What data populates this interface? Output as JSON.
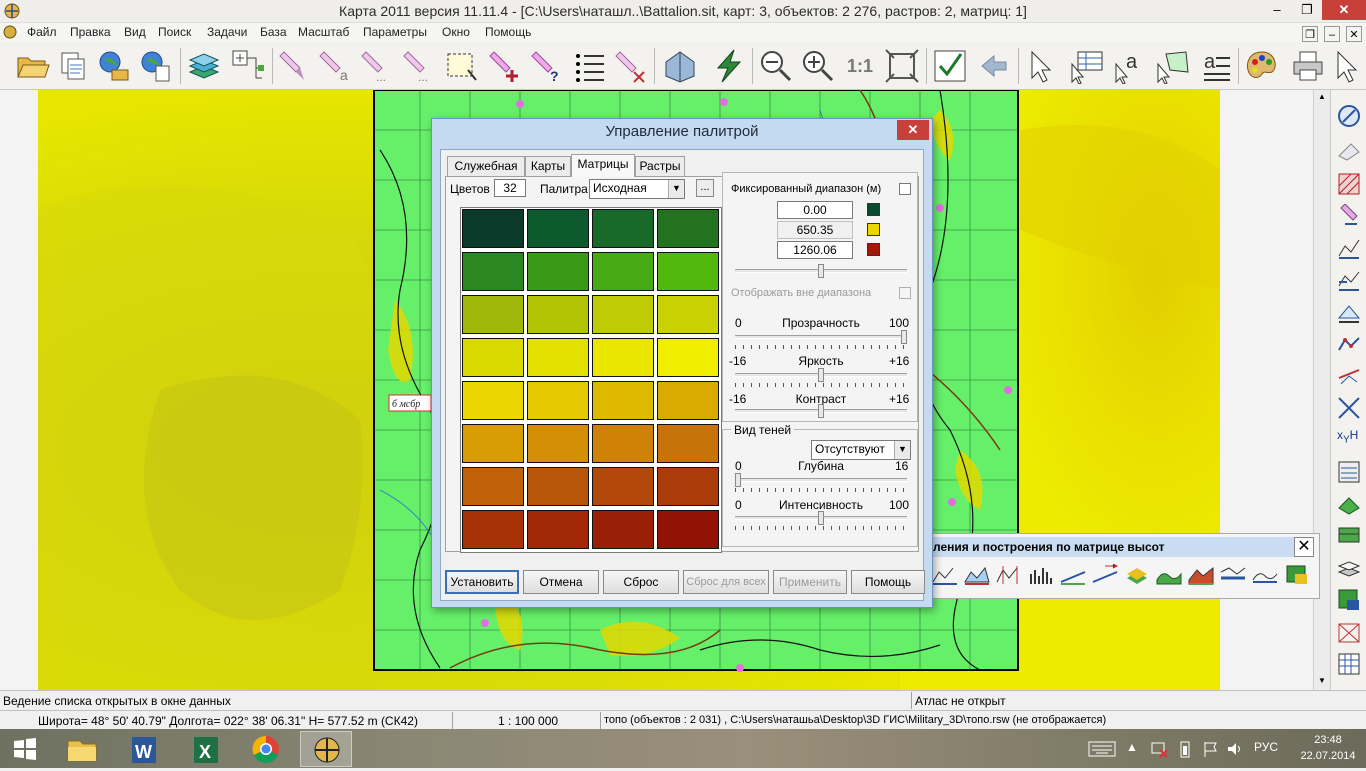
{
  "window": {
    "title": "Карта 2011 версия 11.11.4 - [C:\\Users\\наташл..\\Battalion.sit, карт: 3, объектов: 2 276, растров: 2, матриц: 1]",
    "min": "–",
    "max": "❐",
    "close": "✕"
  },
  "menu": {
    "items": [
      "Файл",
      "Правка",
      "Вид",
      "Поиск",
      "Задачи",
      "База",
      "Масштаб",
      "Параметры",
      "Окно",
      "Помощь"
    ]
  },
  "toolbar": {
    "scale_one": "1:1"
  },
  "map": {
    "unit_label": "б мсбр"
  },
  "matrix_panel": {
    "title": "ления и построения по матрице высот",
    "close": "✕"
  },
  "dialog": {
    "title": "Управление палитрой",
    "close": "✕",
    "tabs": [
      "Служебная",
      "Карты",
      "Матрицы",
      "Растры"
    ],
    "active_tab": "Матрицы",
    "colors_label": "Цветов",
    "colors_value": "32",
    "palette_label": "Палитра",
    "palette_value": "Исходная",
    "more": "...",
    "swatches": [
      "#0b3a2b",
      "#0d5a2e",
      "#196a2a",
      "#23721f",
      "#2b8722",
      "#3a9a18",
      "#46aa14",
      "#52b80e",
      "#9fb80a",
      "#b2c406",
      "#bfcc05",
      "#cbd203",
      "#d9d900",
      "#e3e100",
      "#ebe600",
      "#f2ee00",
      "#ecd600",
      "#e6c800",
      "#dfb800",
      "#d9aa00",
      "#d89d05",
      "#d48f06",
      "#cf8208",
      "#c8730a",
      "#c1620a",
      "#b8560a",
      "#b2490a",
      "#ab3c09",
      "#a83208",
      "#a22808",
      "#9b1e07",
      "#931206"
    ],
    "fixed_range": {
      "label": "Фиксированный диапазон (м)",
      "min": "0.00",
      "mid": "650.35",
      "max": "1260.06",
      "min_color": "#0b4a2e",
      "mid_color": "#ecd600",
      "max_color": "#a01a07",
      "slider": 0.5,
      "outside_label": "Отображать вне диапазона"
    },
    "transparency": {
      "label": "Прозрачность",
      "min": "0",
      "max": "100",
      "value": 100
    },
    "brightness": {
      "label": "Яркость",
      "min": "-16",
      "max": "+16",
      "value": 0
    },
    "contrast": {
      "label": "Контраст",
      "min": "-16",
      "max": "+16",
      "value": 0
    },
    "shadows": {
      "group_label": "Вид теней",
      "type_value": "Отсутствуют",
      "depth": {
        "label": "Глубина",
        "min": "0",
        "max": "16",
        "value": 0
      },
      "intensity": {
        "label": "Интенсивность",
        "min": "0",
        "max": "100",
        "value": 50
      }
    },
    "buttons": {
      "install": "Установить",
      "cancel": "Отмена",
      "reset": "Сброс",
      "reset_all": "Сброс для всех",
      "apply": "Применить",
      "help": "Помощь"
    }
  },
  "status": {
    "left": "Ведение списка открытых в окне данных",
    "atlas": "Атлас не открыт",
    "coords": "Широта= 48° 50' 40.79\" Долгота= 022° 38' 06.31\" H= 577.52 m  (СК42)",
    "scale": "1 : 100 000",
    "layer": "топо   (объектов : 2 031) , C:\\Users\\наташьа\\Desktop\\3D ГИС\\Military_3D\\топо.rsw (не отображается)"
  },
  "taskbar": {
    "lang": "РУС",
    "time": "23:48",
    "date": "22.07.2014"
  }
}
